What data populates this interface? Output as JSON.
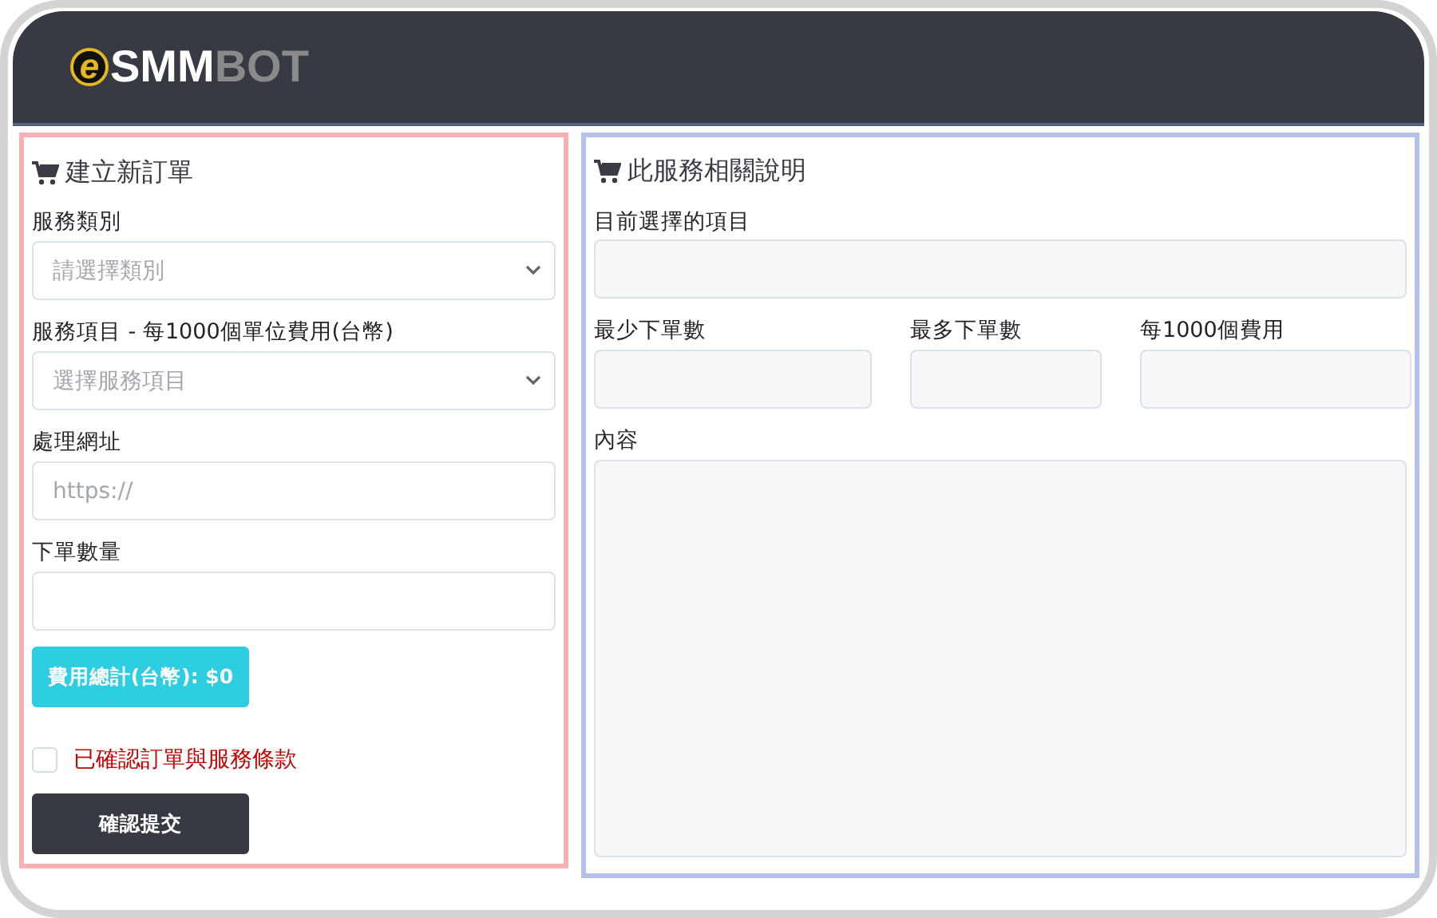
{
  "header": {
    "logo": {
      "mark": "e",
      "part_1": "SMM",
      "part_2": "BOT"
    }
  },
  "order_form": {
    "title": "建立新訂單",
    "fields": [
      {
        "kind": "select",
        "label": "服務類別",
        "placeholder": "請選擇類別"
      },
      {
        "kind": "select",
        "label": "服務項目 - 每1000個單位費用(台幣)",
        "placeholder": "選擇服務項目"
      },
      {
        "kind": "input",
        "label": "處理網址",
        "placeholder": "https://"
      },
      {
        "kind": "input",
        "label": "下單數量"
      }
    ],
    "total_button": "費用總計(台幣): $0",
    "agreement": {
      "label": "已確認訂單與服務條款",
      "checked": false
    },
    "submit_button": "確認提交"
  },
  "service_info": {
    "title": "此服務相關說明",
    "selected_item": {
      "label": "目前選擇的項目"
    },
    "stats": [
      {
        "label": "最少下單數"
      },
      {
        "label": "最多下單數"
      },
      {
        "label": "每1000個費用"
      }
    ],
    "content": {
      "label": "內容"
    }
  }
}
